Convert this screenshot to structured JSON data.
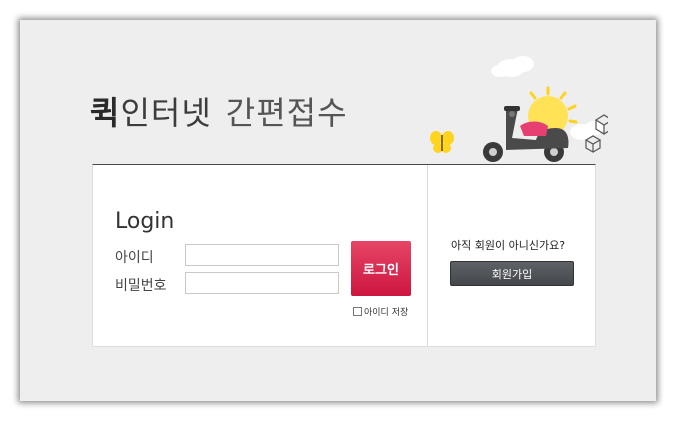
{
  "header": {
    "title_bold": "퀵",
    "title_rest": "인터넷",
    "title_light": "간편접수"
  },
  "login": {
    "heading_main": "Log",
    "heading_accent": "in",
    "id_label": "아이디",
    "pw_label": "비밀번호",
    "id_value": "",
    "pw_value": "",
    "button_label": "로그인",
    "save_label": "아이디 저장"
  },
  "signup": {
    "question": "아직 회원이 아니신가요?",
    "button_label": "회원가입"
  },
  "colors": {
    "login_button": "#d81d47",
    "join_button": "#515459",
    "background": "#eeeeee"
  },
  "icons": [
    "butterfly-icon",
    "scooter-icon",
    "sun-icon",
    "cloud-icon",
    "box-icon"
  ]
}
